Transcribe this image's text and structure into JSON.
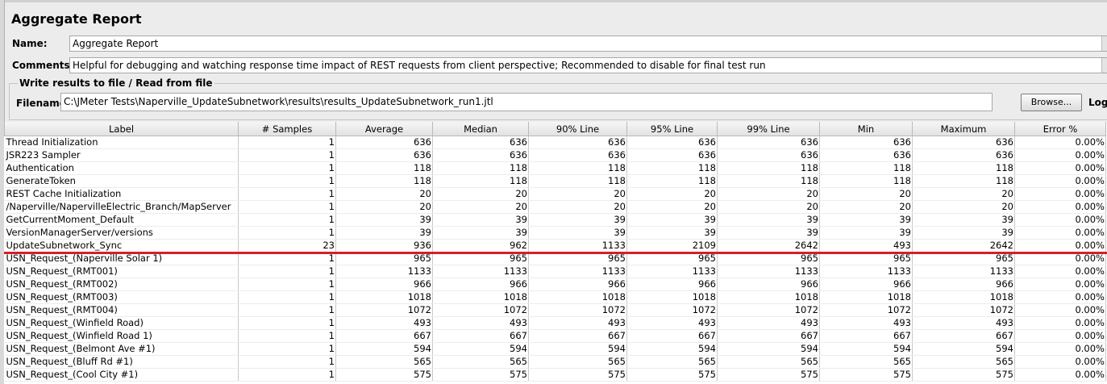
{
  "panel_title": "Aggregate Report",
  "name_field": {
    "label": "Name:",
    "value": "Aggregate Report"
  },
  "comments_field": {
    "label": "Comments:",
    "value": "Helpful for debugging and watching response time impact of REST requests from client perspective; Recommended to disable for final test run"
  },
  "file_group": {
    "title": "Write results to file / Read from file",
    "filename_label": "Filename",
    "filename_value": "C:\\JMeter Tests\\Naperville_UpdateSubnetwork\\results\\results_UpdateSubnetwork_run1.jtl",
    "browse_label": "Browse...",
    "log_label": "Log"
  },
  "table": {
    "headers": [
      "Label",
      "# Samples",
      "Average",
      "Median",
      "90% Line",
      "95% Line",
      "99% Line",
      "Min",
      "Maximum",
      "Error %"
    ],
    "rows": [
      [
        "Thread Initialization",
        "1",
        "636",
        "636",
        "636",
        "636",
        "636",
        "636",
        "636",
        "0.00%"
      ],
      [
        "JSR223 Sampler",
        "1",
        "636",
        "636",
        "636",
        "636",
        "636",
        "636",
        "636",
        "0.00%"
      ],
      [
        "Authentication",
        "1",
        "118",
        "118",
        "118",
        "118",
        "118",
        "118",
        "118",
        "0.00%"
      ],
      [
        "GenerateToken",
        "1",
        "118",
        "118",
        "118",
        "118",
        "118",
        "118",
        "118",
        "0.00%"
      ],
      [
        "REST Cache Initialization",
        "1",
        "20",
        "20",
        "20",
        "20",
        "20",
        "20",
        "20",
        "0.00%"
      ],
      [
        "/Naperville/NapervilleElectric_Branch/MapServer",
        "1",
        "20",
        "20",
        "20",
        "20",
        "20",
        "20",
        "20",
        "0.00%"
      ],
      [
        "GetCurrentMoment_Default",
        "1",
        "39",
        "39",
        "39",
        "39",
        "39",
        "39",
        "39",
        "0.00%"
      ],
      [
        "VersionManagerServer/versions",
        "1",
        "39",
        "39",
        "39",
        "39",
        "39",
        "39",
        "39",
        "0.00%"
      ],
      [
        "UpdateSubnetwork_Sync",
        "23",
        "936",
        "962",
        "1133",
        "2109",
        "2642",
        "493",
        "2642",
        "0.00%"
      ],
      [
        "USN_Request_(Naperville Solar 1)",
        "1",
        "965",
        "965",
        "965",
        "965",
        "965",
        "965",
        "965",
        "0.00%"
      ],
      [
        "USN_Request_(RMT001)",
        "1",
        "1133",
        "1133",
        "1133",
        "1133",
        "1133",
        "1133",
        "1133",
        "0.00%"
      ],
      [
        "USN_Request_(RMT002)",
        "1",
        "966",
        "966",
        "966",
        "966",
        "966",
        "966",
        "966",
        "0.00%"
      ],
      [
        "USN_Request_(RMT003)",
        "1",
        "1018",
        "1018",
        "1018",
        "1018",
        "1018",
        "1018",
        "1018",
        "0.00%"
      ],
      [
        "USN_Request_(RMT004)",
        "1",
        "1072",
        "1072",
        "1072",
        "1072",
        "1072",
        "1072",
        "1072",
        "0.00%"
      ],
      [
        "USN_Request_(Winfield Road)",
        "1",
        "493",
        "493",
        "493",
        "493",
        "493",
        "493",
        "493",
        "0.00%"
      ],
      [
        "USN_Request_(Winfield Road 1)",
        "1",
        "667",
        "667",
        "667",
        "667",
        "667",
        "667",
        "667",
        "0.00%"
      ],
      [
        "USN_Request_(Belmont Ave #1)",
        "1",
        "594",
        "594",
        "594",
        "594",
        "594",
        "594",
        "594",
        "0.00%"
      ],
      [
        "USN_Request_(Bluff Rd #1)",
        "1",
        "565",
        "565",
        "565",
        "565",
        "565",
        "565",
        "565",
        "0.00%"
      ],
      [
        "USN_Request_(Cool City #1)",
        "1",
        "575",
        "575",
        "575",
        "575",
        "575",
        "575",
        "575",
        "0.00%"
      ]
    ]
  },
  "colors": {
    "highlight_line": "#d3202a"
  }
}
